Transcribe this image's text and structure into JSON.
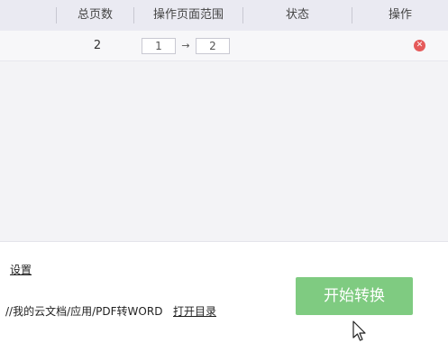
{
  "table": {
    "columns": [
      "总页数",
      "操作页面范围",
      "状态",
      "操作"
    ],
    "rows": [
      {
        "total_pages": "2",
        "range_start": "1",
        "range_arrow": "→",
        "range_end": "2",
        "status": "",
        "delete_glyph": "✕"
      }
    ]
  },
  "settings_label": "设置",
  "output": {
    "path": "//我的云文档/应用/PDF转WORD",
    "open_dir_label": "打开目录"
  },
  "start_button_label": "开始转换",
  "colors": {
    "header_bg": "#eaeaf2",
    "button_green": "#7fcb81",
    "delete_red": "#e55a5a"
  },
  "icons": {
    "delete": "delete-icon",
    "cursor": "cursor-icon"
  }
}
